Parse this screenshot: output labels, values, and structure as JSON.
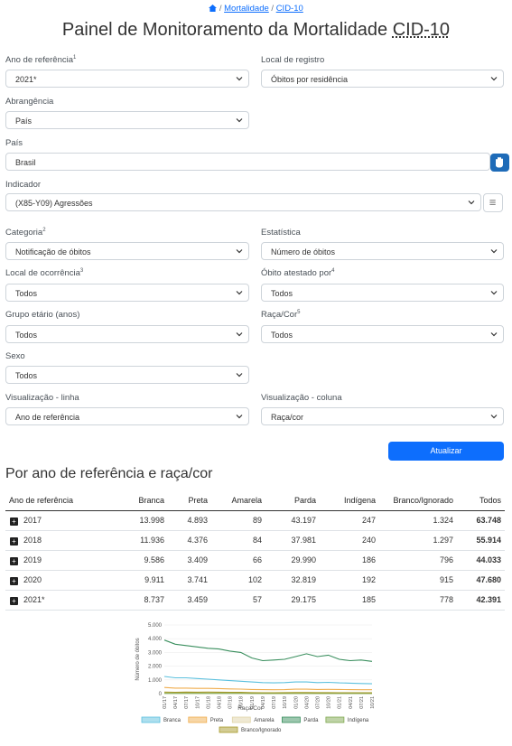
{
  "breadcrumb": {
    "sep": "/",
    "items": [
      "Mortalidade",
      "CID-10"
    ]
  },
  "title": {
    "main": "Painel de Monitoramento da Mortalidade",
    "abbr": "CID-10"
  },
  "filters": {
    "ano": {
      "label": "Ano de referência",
      "sup": "1",
      "value": "2021*"
    },
    "local_registro": {
      "label": "Local de registro",
      "value": "Óbitos por residência"
    },
    "abrangencia": {
      "label": "Abrangência",
      "value": "País"
    },
    "pais": {
      "label": "País",
      "value": "Brasil"
    },
    "indicador": {
      "label": "Indicador",
      "value": "(X85-Y09) Agressões"
    },
    "categoria": {
      "label": "Categoria",
      "sup": "2",
      "value": "Notificação de óbitos"
    },
    "estatistica": {
      "label": "Estatística",
      "value": "Número de óbitos"
    },
    "local_ocorrencia": {
      "label": "Local de ocorrência",
      "sup": "3",
      "value": "Todos"
    },
    "obito_atestado": {
      "label": "Óbito atestado por",
      "sup": "4",
      "value": "Todos"
    },
    "grupo_etario": {
      "label": "Grupo etário (anos)",
      "value": "Todos"
    },
    "raca_cor": {
      "label": "Raça/Cor",
      "sup": "5",
      "value": "Todos"
    },
    "sexo": {
      "label": "Sexo",
      "value": "Todos"
    },
    "vis_linha": {
      "label": "Visualização - linha",
      "value": "Ano de referência"
    },
    "vis_coluna": {
      "label": "Visualização - coluna",
      "value": "Raça/cor"
    }
  },
  "update_button": "Atualizar",
  "section_title": "Por ano de referência e raça/cor",
  "table": {
    "headers": [
      "Ano de referência",
      "Branca",
      "Preta",
      "Amarela",
      "Parda",
      "Indígena",
      "Branco/Ignorado",
      "Todos"
    ],
    "rows": [
      [
        "2017",
        "13.998",
        "4.893",
        "89",
        "43.197",
        "247",
        "1.324",
        "63.748"
      ],
      [
        "2018",
        "11.936",
        "4.376",
        "84",
        "37.981",
        "240",
        "1.297",
        "55.914"
      ],
      [
        "2019",
        "9.586",
        "3.409",
        "66",
        "29.990",
        "186",
        "796",
        "44.033"
      ],
      [
        "2020",
        "9.911",
        "3.741",
        "102",
        "32.819",
        "192",
        "915",
        "47.680"
      ],
      [
        "2021*",
        "8.737",
        "3.459",
        "57",
        "29.175",
        "185",
        "778",
        "42.391"
      ]
    ]
  },
  "chart_data": {
    "type": "line",
    "ylabel": "Número de óbitos",
    "xlabel": "Raça/Cor",
    "ylim": [
      0,
      5000
    ],
    "yticks": [
      "5.000",
      "4.000",
      "3.000",
      "2.000",
      "1.000",
      "0"
    ],
    "x": [
      "01/17",
      "04/17",
      "07/17",
      "10/17",
      "01/18",
      "04/18",
      "07/18",
      "10/18",
      "01/19",
      "04/19",
      "07/19",
      "10/19",
      "01/20",
      "04/20",
      "07/20",
      "10/20",
      "01/21",
      "04/21",
      "07/21",
      "10/21"
    ],
    "series": [
      {
        "name": "Branca",
        "color": "#5bc0de",
        "values": [
          1250,
          1150,
          1150,
          1100,
          1050,
          1000,
          950,
          900,
          850,
          800,
          780,
          800,
          850,
          850,
          800,
          820,
          780,
          760,
          740,
          720
        ]
      },
      {
        "name": "Preta",
        "color": "#f0ad4e",
        "values": [
          450,
          400,
          400,
          380,
          380,
          370,
          340,
          330,
          300,
          290,
          280,
          290,
          320,
          320,
          300,
          310,
          300,
          290,
          280,
          280
        ]
      },
      {
        "name": "Amarela",
        "color": "#e0d4a8",
        "values": [
          8,
          8,
          8,
          7,
          7,
          7,
          7,
          6,
          6,
          6,
          6,
          6,
          8,
          8,
          9,
          9,
          5,
          5,
          5,
          5
        ]
      },
      {
        "name": "Parda",
        "color": "#3a8f5e",
        "values": [
          3900,
          3600,
          3500,
          3400,
          3300,
          3250,
          3100,
          3000,
          2600,
          2400,
          2450,
          2500,
          2700,
          2900,
          2700,
          2800,
          2500,
          2400,
          2450,
          2350
        ]
      },
      {
        "name": "Indígena",
        "color": "#7fa84f",
        "values": [
          22,
          20,
          20,
          20,
          20,
          19,
          18,
          17,
          16,
          15,
          16,
          16,
          16,
          16,
          16,
          16,
          15,
          15,
          15,
          15
        ]
      },
      {
        "name": "Branco/Ignorado",
        "color": "#a89a2a",
        "values": [
          110,
          100,
          110,
          105,
          110,
          105,
          100,
          95,
          70,
          65,
          65,
          70,
          80,
          80,
          75,
          75,
          65,
          65,
          65,
          60
        ]
      }
    ]
  }
}
